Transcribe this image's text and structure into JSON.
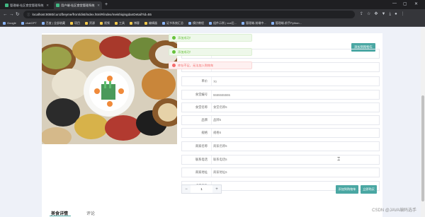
{
  "browser": {
    "tabs": [
      {
        "title": "管理端-社区食堂管理系统",
        "active": false
      },
      {
        "title": "用户端-社区食堂管理系统",
        "active": true
      }
    ],
    "url": "localhost:8080/cun1fbeyme/front/dist/index.html#/index/meishiqingdanDetail?id=55",
    "bookmarks": [
      {
        "label": "Google",
        "folder": false
      },
      {
        "label": "chatGPT",
        "folder": false
      },
      {
        "label": "百度 | 全部收藏",
        "folder": false
      },
      {
        "label": "项目",
        "folder": true
      },
      {
        "label": "资源",
        "folder": true
      },
      {
        "label": "视频",
        "folder": true
      },
      {
        "label": "工具",
        "folder": true
      },
      {
        "label": "博客",
        "folder": true
      },
      {
        "label": "编辑器",
        "folder": true
      },
      {
        "label": "证书系统汇总",
        "folder": false
      },
      {
        "label": "模仿教程",
        "folder": false
      },
      {
        "label": "组件示例 | vue后...",
        "folder": false
      },
      {
        "label": "管理端-前端中...",
        "folder": false
      },
      {
        "label": "管理端-前手Python...",
        "folder": false
      }
    ]
  },
  "toasts": [
    {
      "type": "ok",
      "text": "添加成功！"
    },
    {
      "type": "ok",
      "text": "添加成功！"
    },
    {
      "type": "err",
      "text": "库存不足，无法加入购物车"
    }
  ],
  "detail": {
    "cart_button": "添加到购物车",
    "fields": [
      {
        "label": "",
        "value": ""
      },
      {
        "label": "数量",
        "value": "5"
      },
      {
        "label": "单价",
        "value": "70"
      },
      {
        "label": "食堂编号",
        "value": "5555555555"
      },
      {
        "label": "食堂名称",
        "value": "食堂名称5"
      },
      {
        "label": "品牌",
        "value": "品牌5"
      },
      {
        "label": "规格",
        "value": "规格5"
      },
      {
        "label": "商家名称",
        "value": "商家名称5"
      },
      {
        "label": "联系电话",
        "value": "联系电话5"
      },
      {
        "label": "商家地址",
        "value": "商家地址5"
      },
      {
        "label": "点击次数",
        "value": "7"
      }
    ],
    "quantity": "1",
    "minus": "−",
    "plus": "+",
    "add_cart_label": "添加到购物车",
    "buy_now_label": "立即购买"
  },
  "lower_tabs": {
    "first": "美食详情",
    "second": "评论"
  },
  "watermark": "CSDN @JAVA编码选手",
  "colors": {
    "accent": "#4aa7a3",
    "success": "#67c23a",
    "error": "#f56c6c"
  }
}
